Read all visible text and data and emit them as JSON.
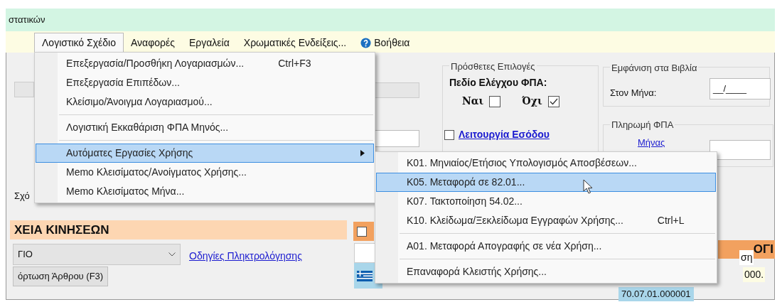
{
  "title_bar": {
    "text": "στατικών"
  },
  "menu_bar": [
    {
      "label": "Λογιστικό Σχέδιο",
      "selected": true,
      "kind": "plain"
    },
    {
      "label": "Αναφορές",
      "selected": false,
      "kind": "plain"
    },
    {
      "label": "Εργαλεία",
      "selected": false,
      "kind": "plain"
    },
    {
      "label": "Χρωματικές Ενδείξεις...",
      "selected": false,
      "kind": "plain"
    },
    {
      "label": "Βοήθεια",
      "selected": false,
      "kind": "help"
    }
  ],
  "dropdown": [
    {
      "kind": "item",
      "label": "Επεξεργασία/Προσθήκη Λογαριασμών...",
      "shortcut": "Ctrl+F3",
      "selected": false
    },
    {
      "kind": "item",
      "label": "Επεξεργασία Επιπέδων...",
      "selected": false
    },
    {
      "kind": "item",
      "label": "Κλείσιμο/Άνοιγμα Λογαριασμού...",
      "selected": false
    },
    {
      "kind": "separator"
    },
    {
      "kind": "item",
      "label": "Λογιστική Εκκαθάριση ΦΠΑ Μηνός...",
      "selected": false
    },
    {
      "kind": "separator"
    },
    {
      "kind": "submenu",
      "label": "Αυτόματες Εργασίες Χρήσης",
      "selected": true
    },
    {
      "kind": "item",
      "label": "Memo Κλεισίματος/Ανοίγματος Χρήσης...",
      "selected": false
    },
    {
      "kind": "item",
      "label": "Memo Κλεισίματος Μήνα...",
      "selected": false
    }
  ],
  "submenu": [
    {
      "kind": "item",
      "label": "K01. Μηνιαίος/Ετήσιος Υπολογισμός Αποσβέσεων...",
      "selected": false
    },
    {
      "kind": "item",
      "label": "K05. Μεταφορά σε 82.01...",
      "selected": true
    },
    {
      "kind": "item",
      "label": "K07. Τακτοποίηση 54.02...",
      "selected": false
    },
    {
      "kind": "item",
      "label": "K10. Κλείδωμα/Ξεκλείδωμα Εγγραφών Χρήσης...",
      "shortcut": "Ctrl+L",
      "selected": false
    },
    {
      "kind": "separator"
    },
    {
      "kind": "item",
      "label": "A01. Μεταφορά Απογραφής σε νέα Χρήση...",
      "selected": false
    },
    {
      "kind": "separator"
    },
    {
      "kind": "item",
      "label": "Επαναφορά Κλειστής Χρήσης...",
      "selected": false
    }
  ],
  "extra_options": {
    "title": "Πρόσθετες Επιλογές",
    "vat_check_label": "Πεδίο Ελέγχου ΦΠΑ:",
    "choices": [
      {
        "label": "Ναι",
        "checked": false
      },
      {
        "label": "Όχι",
        "checked": true
      }
    ],
    "income_mode": {
      "label": "Λειτουργία Εσόδου",
      "checked": false
    }
  },
  "books": {
    "title": "Εμφάνιση στα Βιβλία",
    "month_label": "Στον Μήνα:",
    "month_value": "__/____"
  },
  "vat_payment": {
    "title": "Πληρωμή ΦΠΑ",
    "month_link": "Μήνας"
  },
  "left_label": "Σχό",
  "section_header": "ΧΕΙΑ ΚΙΝΗΣΕΩΝ",
  "section_checkbox": {
    "checked": false
  },
  "combo_value": "ΓΙΟ",
  "typing_help_link": "Οδηγίες Πληκτρολόγησης",
  "load_button": "όρτωση Άρθρου (F3)",
  "right_header": "ΟΓΙ",
  "table": {
    "column_1": "ση",
    "cells": [
      "000.",
      "70.07.01.000001"
    ]
  }
}
